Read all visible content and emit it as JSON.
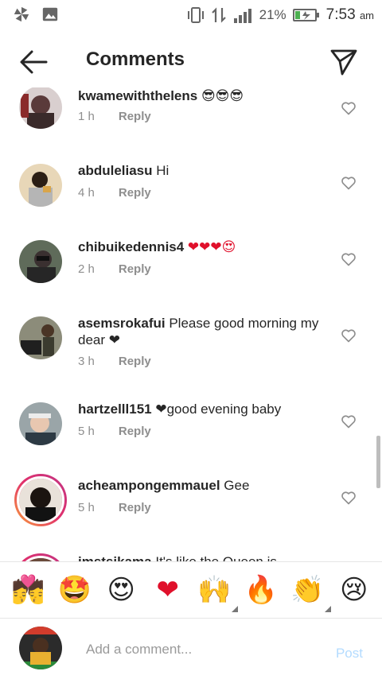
{
  "status_bar": {
    "battery": "21%",
    "time": "7:53",
    "ampm": "am",
    "icons": [
      "pinwheel-icon",
      "gallery-icon",
      "vibrate-icon",
      "data-arrows-icon",
      "signal-icon",
      "battery-charging-icon"
    ]
  },
  "header": {
    "title": "Comments",
    "back_icon": "arrow-left-icon",
    "share_icon": "paper-plane-icon"
  },
  "comments": [
    {
      "username": "kwamewiththelens",
      "text": " 😎😎😎",
      "time": "1 h",
      "reply": "Reply"
    },
    {
      "username": "abduleliasu",
      "text": " Hi",
      "time": "4 h",
      "reply": "Reply"
    },
    {
      "username": "chibuikedennis4",
      "text": " ❤❤❤😍",
      "time": "2 h",
      "reply": "Reply"
    },
    {
      "username": "asemsrokafui",
      "text": " Please good morning my dear ❤",
      "time": "3 h",
      "reply": "Reply"
    },
    {
      "username": "hartzelll151",
      "text": " ❤good evening baby",
      "time": "5 h",
      "reply": "Reply"
    },
    {
      "username": "acheampongemmauel",
      "text": " Gee",
      "time": "5 h",
      "reply": "Reply"
    },
    {
      "username": "imstsikama",
      "text": " It's like the Queen is",
      "time": "",
      "reply": ""
    }
  ],
  "emoji_bar": [
    {
      "name": "couple-kiss-emoji",
      "glyph": "💏"
    },
    {
      "name": "star-struck-emoji",
      "glyph": "🤩"
    },
    {
      "name": "heart-eyes-emoji",
      "glyph": "😍"
    },
    {
      "name": "red-heart-emoji",
      "glyph": "❤"
    },
    {
      "name": "raising-hands-emoji",
      "glyph": "🙌"
    },
    {
      "name": "fire-emoji",
      "glyph": "🔥"
    },
    {
      "name": "clapping-hands-emoji",
      "glyph": "👏"
    },
    {
      "name": "crying-face-emoji",
      "glyph": "😢"
    }
  ],
  "composer": {
    "placeholder": "Add a comment...",
    "post_label": "Post"
  },
  "colors": {
    "heart_red": "#e0102b",
    "post_disabled": "#b3dbff",
    "meta_gray": "#8e8e8e",
    "story_ring": "#e1306c"
  }
}
